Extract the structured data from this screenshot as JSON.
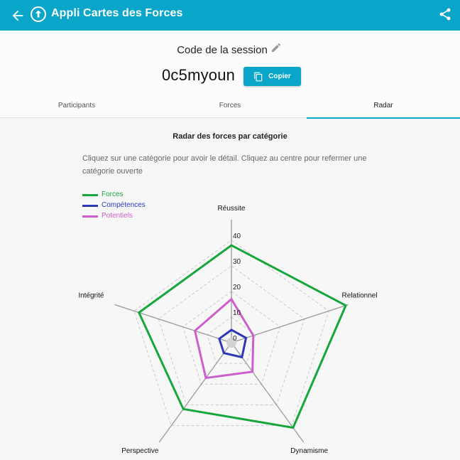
{
  "app": {
    "title": "Appli Cartes des Forces",
    "colors": {
      "primary": "#0aa6c9",
      "forces": "#17a63c",
      "competences": "#2c38b8",
      "potentiels": "#cc5fcc"
    }
  },
  "session": {
    "label": "Code de la session",
    "code": "0c5myoun",
    "copy_label": "Copier"
  },
  "tabs": [
    {
      "label": "Participants",
      "active": false
    },
    {
      "label": "Forces",
      "active": false
    },
    {
      "label": "Radar",
      "active": true
    }
  ],
  "radar": {
    "title": "Radar des forces par catégorie",
    "hint": "Cliquez sur une catégorie pour avoir le détail. Cliquez au centre pour refermer une catégorie ouverte"
  },
  "chart_data": {
    "type": "radar",
    "categories": [
      "Réussite",
      "Relationnel",
      "Dynamisme",
      "Perspective",
      "Intégrité"
    ],
    "ticks": [
      0,
      10,
      20,
      30,
      40
    ],
    "range": [
      0,
      48
    ],
    "grid": true,
    "legend_position": "top-left",
    "series": [
      {
        "name": "Forces",
        "values": [
          38,
          47,
          41,
          32,
          38
        ]
      },
      {
        "name": "Compétences",
        "values": [
          5,
          6,
          7,
          5,
          5
        ]
      },
      {
        "name": "Potentiels",
        "values": [
          17,
          9,
          14,
          17,
          15
        ]
      }
    ]
  }
}
